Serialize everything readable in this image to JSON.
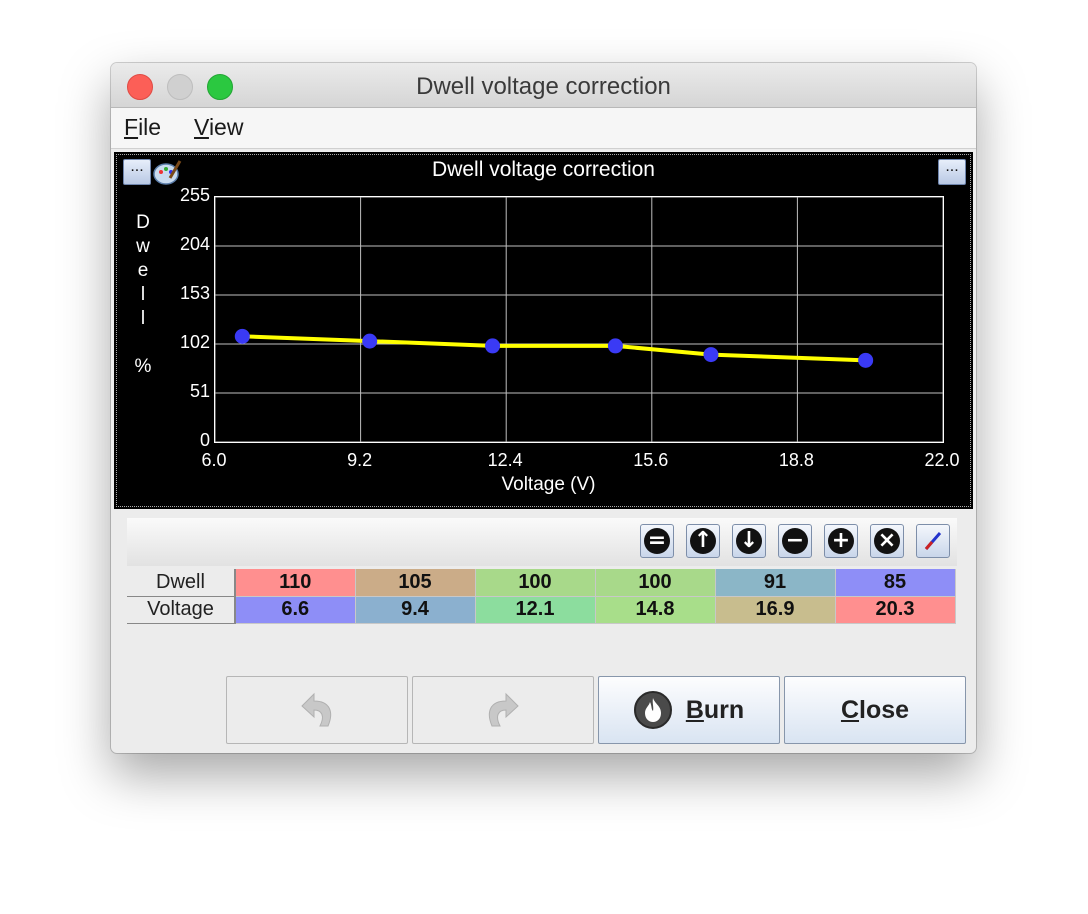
{
  "window": {
    "title": "Dwell voltage correction"
  },
  "menu": {
    "file": {
      "mnemonic": "F",
      "rest": "ile"
    },
    "view": {
      "mnemonic": "V",
      "rest": "iew"
    }
  },
  "chart": {
    "more_left": "...",
    "more_right": "..."
  },
  "chart_data": {
    "type": "line",
    "title": "Dwell voltage correction",
    "xlabel": "Voltage (V)",
    "ylabel": "Dwell %",
    "ylabel_chars": [
      "D",
      "w",
      "e",
      "l",
      "l",
      "",
      "%"
    ],
    "xlim": [
      6.0,
      22.0
    ],
    "ylim": [
      0,
      255
    ],
    "x_ticks": [
      "6.0",
      "9.2",
      "12.4",
      "15.6",
      "18.8",
      "22.0"
    ],
    "y_ticks": [
      "255",
      "204",
      "153",
      "102",
      "51",
      "0"
    ],
    "grid": true,
    "series": [
      {
        "x": [
          6.6,
          9.4,
          12.1,
          14.8,
          16.9,
          20.3
        ],
        "y": [
          110,
          105,
          100,
          100,
          91,
          85
        ],
        "line_color": "#ffff00",
        "point_color": "#3a3af5"
      }
    ]
  },
  "toolbar": {
    "buttons": [
      "equalize",
      "increase",
      "decrease",
      "subtract",
      "add",
      "multiply",
      "interpolate"
    ],
    "glyphs": [
      "=",
      "↑",
      "↓",
      "−",
      "+",
      "×",
      "/"
    ]
  },
  "table": {
    "rows": [
      {
        "label": "Dwell",
        "values": [
          "110",
          "105",
          "100",
          "100",
          "91",
          "85"
        ],
        "colors": [
          "#ff8f8f",
          "#cbac88",
          "#a8d98a",
          "#a8d98a",
          "#8bb6c7",
          "#8e8ef7"
        ]
      },
      {
        "label": "Voltage",
        "values": [
          "6.6",
          "9.4",
          "12.1",
          "14.8",
          "16.9",
          "20.3"
        ],
        "colors": [
          "#8e8ef7",
          "#8bb0cf",
          "#8cdd9e",
          "#a8de8a",
          "#c8bd8e",
          "#ff8f8f"
        ]
      }
    ]
  },
  "buttons": {
    "undo_icon": "undo-arrow-icon",
    "redo_icon": "redo-arrow-icon",
    "burn": {
      "mnemonic": "B",
      "rest": "urn"
    },
    "close": {
      "mnemonic": "C",
      "rest": "lose"
    }
  }
}
